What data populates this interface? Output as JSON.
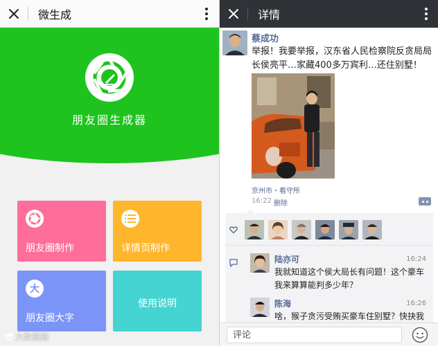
{
  "left": {
    "title": "微生成",
    "app_name": "朋友圈生成器",
    "tiles": [
      {
        "label": "朋友圈制作",
        "icon": "aperture-icon",
        "color": "#ff6e9a"
      },
      {
        "label": "详情页制作",
        "icon": "list-icon",
        "color": "#ffb62c"
      },
      {
        "label": "朋友圈大字",
        "icon": "big-character-icon",
        "icon_text": "大",
        "color": "#7b94f7"
      },
      {
        "label": "使用说明",
        "color": "#44d4d2"
      }
    ],
    "hero_color": "#1ec31e",
    "watermark": "大数据猫"
  },
  "right": {
    "title": "详情",
    "poster": {
      "name": "蔡成功",
      "text": "举报！我要举报，汉东省人民检察院反贪局局长侯亮平…家藏400多万宾利…还住别墅！"
    },
    "location": "京州市・看守所",
    "time": "16:22",
    "delete_label": "删除",
    "comments": [
      {
        "name": "陆亦可",
        "time": "16:24",
        "text": "我就知道这个侯大局长有问题！这个豪车我来算算能判多少年？"
      },
      {
        "name": "陈海",
        "time": "16:26",
        "text": "啥，猴子贪污受贿买豪车住别墅？快抉我起来……"
      }
    ],
    "comment_placeholder": "评论",
    "link_color": "#576b95"
  }
}
